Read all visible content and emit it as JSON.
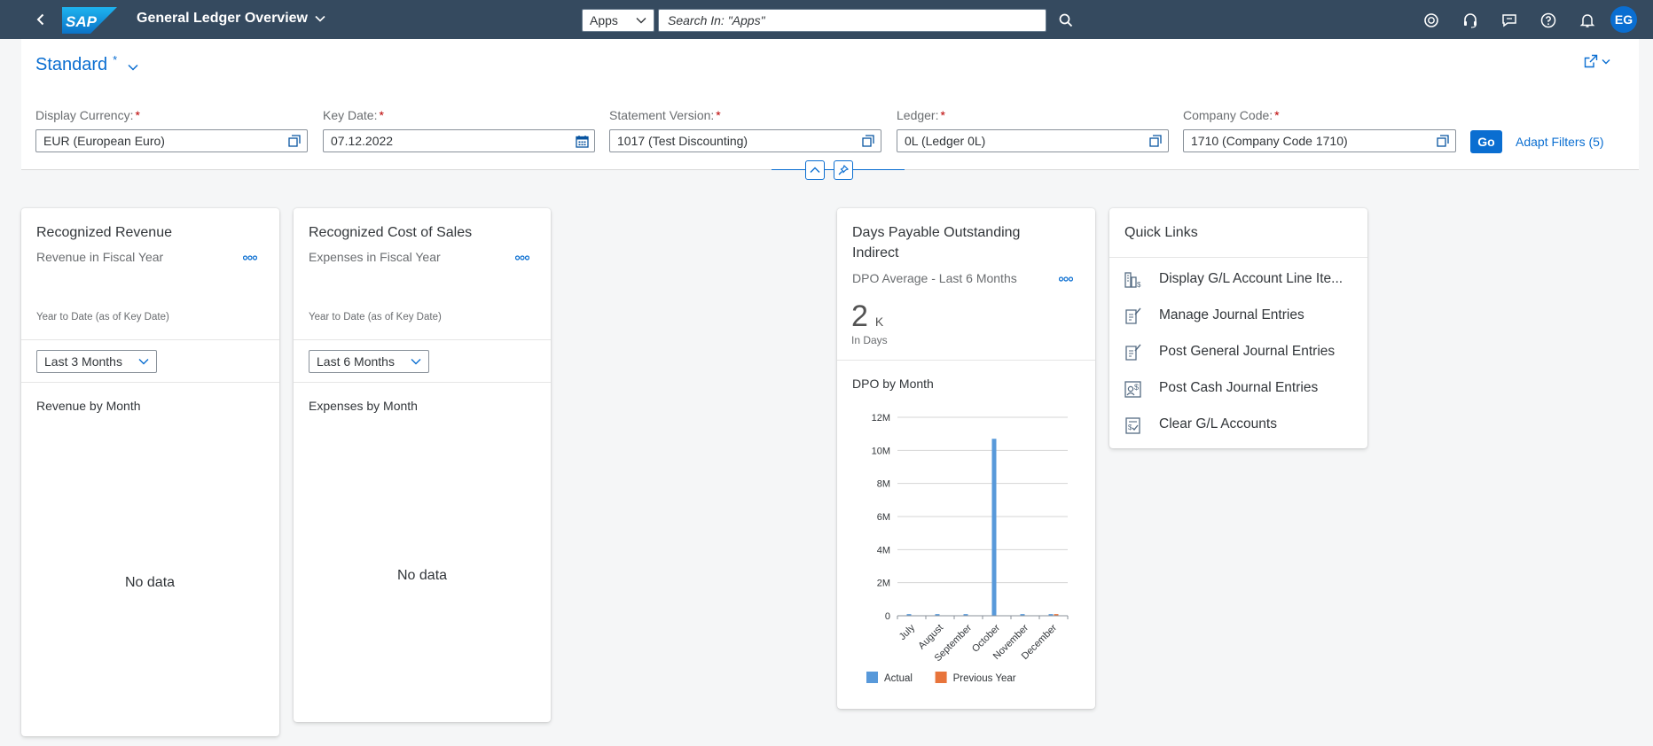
{
  "shell": {
    "app_title": "General Ledger Overview",
    "scope_label": "Apps",
    "search_placeholder": "Search In: \"Apps\"",
    "avatar_initials": "EG",
    "accent": "#0a6ed1",
    "bar_color": "#354a5f"
  },
  "filters": {
    "variant_name": "Standard",
    "variant_modified": "*",
    "fields": [
      {
        "label": "Display Currency:",
        "value": "EUR (European Euro)",
        "icon": "value-help-icon"
      },
      {
        "label": "Key Date:",
        "value": "07.12.2022",
        "icon": "calendar-icon"
      },
      {
        "label": "Statement Version:",
        "value": "1017 (Test Discounting)",
        "icon": "value-help-icon"
      },
      {
        "label": "Ledger:",
        "value": "0L (Ledger 0L)",
        "icon": "value-help-icon"
      },
      {
        "label": "Company Code:",
        "value": "1710 (Company Code 1710)",
        "icon": "value-help-icon"
      }
    ],
    "required_marker": "*",
    "go_label": "Go",
    "adapt_label": "Adapt Filters (5)"
  },
  "cards": {
    "revenue": {
      "title": "Recognized Revenue",
      "subtitle": "Revenue in Fiscal Year",
      "period_note": "Year to Date (as of Key Date)",
      "dropdown_value": "Last 3 Months",
      "section_label": "Revenue by Month",
      "empty_text": "No data"
    },
    "cost": {
      "title": "Recognized Cost of Sales",
      "subtitle": "Expenses in Fiscal Year",
      "period_note": "Year to Date (as of Key Date)",
      "dropdown_value": "Last 6 Months",
      "section_label": "Expenses by Month",
      "empty_text": "No data"
    },
    "dpo": {
      "title_line1": "Days Payable Outstanding",
      "title_line2": "Indirect",
      "subtitle": "DPO Average - Last 6 Months",
      "kpi_value": "2",
      "kpi_unit": "K",
      "kpi_caption": "In Days",
      "section_label": "DPO by Month"
    },
    "quicklinks": {
      "title": "Quick Links",
      "items": [
        {
          "label": "Display G/L Account Line Ite...",
          "icon": "line-items-icon"
        },
        {
          "label": "Manage Journal Entries",
          "icon": "journal-edit-icon"
        },
        {
          "label": "Post General Journal Entries",
          "icon": "journal-post-icon"
        },
        {
          "label": "Post Cash Journal Entries",
          "icon": "cash-journal-icon"
        },
        {
          "label": "Clear G/L Accounts",
          "icon": "clear-accounts-icon"
        }
      ]
    }
  },
  "chart_data": {
    "type": "bar",
    "categories": [
      "July",
      "August",
      "September",
      "October",
      "November",
      "December"
    ],
    "series": [
      {
        "name": "Actual",
        "color": "#5899da",
        "values": [
          0.1,
          0.1,
          0.1,
          10.7,
          0.1,
          0.1
        ]
      },
      {
        "name": "Previous Year",
        "color": "#e8743b",
        "values": [
          0,
          0,
          0,
          0,
          0,
          0.1
        ]
      }
    ],
    "y_unit": "M",
    "ylim": [
      0,
      12
    ],
    "y_ticks": [
      "0",
      "2M",
      "4M",
      "6M",
      "8M",
      "10M",
      "12M"
    ],
    "y_tick_values": [
      0,
      2,
      4,
      6,
      8,
      10,
      12
    ],
    "grid": true,
    "legend_position": "bottom-left"
  }
}
